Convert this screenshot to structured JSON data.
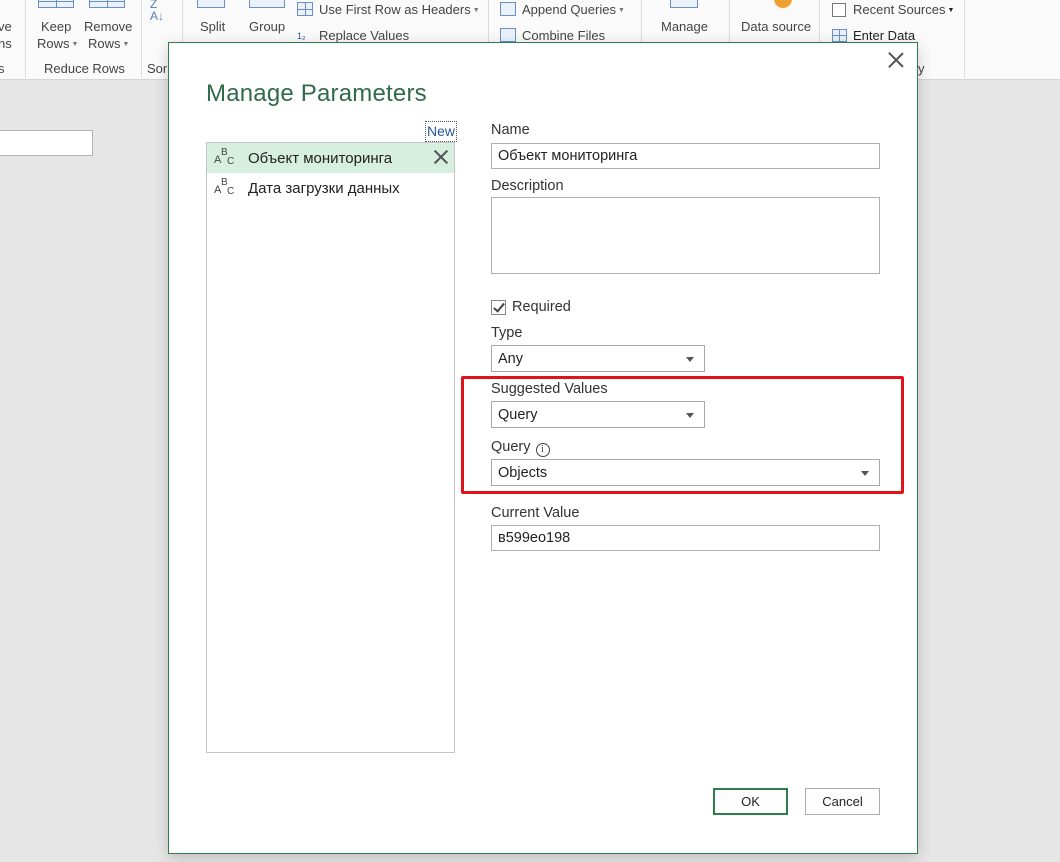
{
  "ribbon": {
    "frag_left_1": "ve",
    "frag_left_2": "ns",
    "frag_left_3": "s",
    "keep_rows_1": "Keep",
    "keep_rows_2": "Rows",
    "remove_rows_1": "Remove",
    "remove_rows_2": "Rows",
    "reduce_rows_group": "Reduce Rows",
    "sort_group_fragment": "Sor",
    "split_column": "Split",
    "group_by": "Group",
    "use_first_row": "Use First Row as Headers",
    "replace_values": "Replace Values",
    "append_queries": "Append Queries",
    "combine_files": "Combine Files",
    "manage_parameters": "Manage",
    "data_source_settings": "Data source",
    "recent_sources": "Recent Sources",
    "enter_data": "Enter Data",
    "new_query_group_fragment": "y"
  },
  "dialog": {
    "title": "Manage Parameters",
    "new_link": "New",
    "parameters": [
      {
        "label": "Объект мониторинга",
        "selected": true
      },
      {
        "label": "Дата загрузки данных",
        "selected": false
      }
    ],
    "name_label": "Name",
    "name_value": "Объект мониторинга",
    "description_label": "Description",
    "description_value": "",
    "required_label": "Required",
    "required_checked": true,
    "type_label": "Type",
    "type_value": "Any",
    "suggested_values_label": "Suggested Values",
    "suggested_values_value": "Query",
    "query_label": "Query",
    "query_value": "Objects",
    "current_value_label": "Current Value",
    "current_value": "в599ео198",
    "ok_label": "OK",
    "cancel_label": "Cancel"
  },
  "colors": {
    "accent_green": "#2e7d4f",
    "title_green": "#2f6b4a",
    "selection_bg": "#d6efdf",
    "highlight_red": "#e0131c"
  }
}
